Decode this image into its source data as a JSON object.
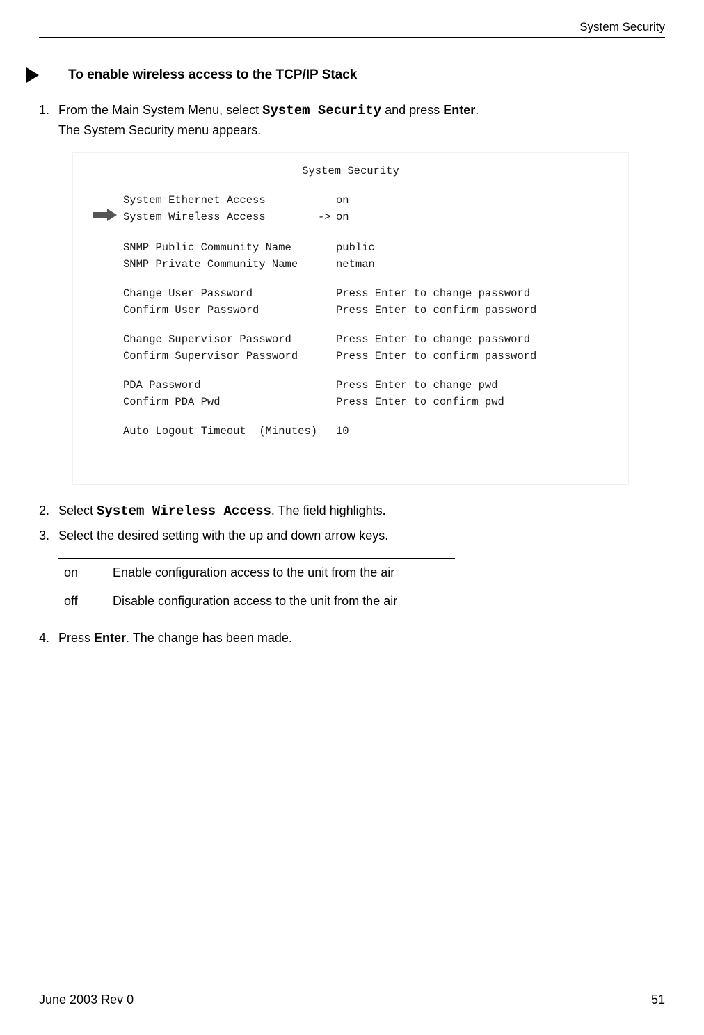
{
  "header": {
    "title": "System Security"
  },
  "heading": "To enable wireless access to the TCP/IP Stack",
  "steps": {
    "s1": {
      "num": "1.",
      "prefix": "From the Main System Menu, select ",
      "code": "System Security",
      "mid": " and press ",
      "bold": "Enter",
      "suffix": ".",
      "line2": "The System Security menu appears."
    },
    "s2": {
      "num": "2.",
      "prefix": "Select ",
      "code": "System Wireless Access",
      "suffix": ". The field highlights."
    },
    "s3": {
      "num": "3.",
      "text": "Select the desired setting with the up and down arrow keys."
    },
    "s4": {
      "num": "4.",
      "prefix": "Press ",
      "bold": "Enter",
      "suffix": ". The change has been made."
    }
  },
  "screenshot": {
    "title": "System Security",
    "rows": [
      {
        "arrow": false,
        "label": "System Ethernet Access",
        "marker": "",
        "value": "on"
      },
      {
        "arrow": true,
        "label": "System Wireless Access",
        "marker": "->",
        "value": "on"
      },
      {
        "gap": true
      },
      {
        "arrow": false,
        "label": "SNMP Public Community Name",
        "marker": "",
        "value": "public"
      },
      {
        "arrow": false,
        "label": "SNMP Private Community Name",
        "marker": "",
        "value": "netman"
      },
      {
        "gap": true
      },
      {
        "arrow": false,
        "label": "Change User Password",
        "marker": "",
        "value": "Press Enter to change password"
      },
      {
        "arrow": false,
        "label": "Confirm User Password",
        "marker": "",
        "value": "Press Enter to confirm password"
      },
      {
        "gap": true
      },
      {
        "arrow": false,
        "label": "Change Supervisor Password",
        "marker": "",
        "value": "Press Enter to change password"
      },
      {
        "arrow": false,
        "label": "Confirm Supervisor Password",
        "marker": "",
        "value": "Press Enter to confirm password"
      },
      {
        "gap": true
      },
      {
        "arrow": false,
        "label": "PDA Password",
        "marker": "",
        "value": "Press Enter to change pwd"
      },
      {
        "arrow": false,
        "label": "Confirm PDA Pwd",
        "marker": "",
        "value": "Press Enter to confirm pwd"
      },
      {
        "gap": true
      },
      {
        "arrow": false,
        "label": "Auto Logout Timeout  (Minutes)",
        "marker": "",
        "value": "10"
      }
    ]
  },
  "settings": [
    {
      "key": "on",
      "desc": "Enable configuration access to the unit from the air"
    },
    {
      "key": "off",
      "desc": "Disable configuration access to the unit from the air"
    }
  ],
  "footer": {
    "left": "June 2003 Rev 0",
    "right": "51"
  }
}
